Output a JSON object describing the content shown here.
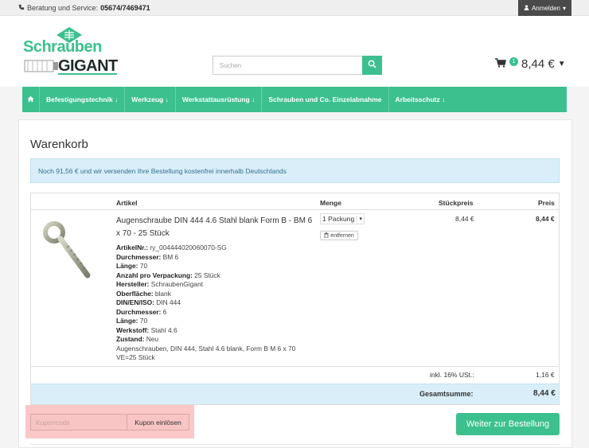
{
  "topbar": {
    "service_label": "Beratung und Service:",
    "service_phone": "05674/7469471",
    "login_label": "Anmelden"
  },
  "header": {
    "logo_top": "Schrauben",
    "logo_bottom": "GIGANT",
    "search_placeholder": "Suchen",
    "cart_count": "1",
    "cart_total": "8,44 €"
  },
  "nav": {
    "items": [
      {
        "label": "Befestigungstechnik",
        "arrow": "🡓"
      },
      {
        "label": "Werkzeug",
        "arrow": "🡓"
      },
      {
        "label": "Werkstattausrüstung",
        "arrow": "🡓"
      },
      {
        "label": "Schrauben und Co. Einzelabnahme",
        "arrow": ""
      },
      {
        "label": "Arbeitsschutz",
        "arrow": "🡓"
      }
    ]
  },
  "cart": {
    "title": "Warenkorb",
    "notice": "Noch 91,56 € und wir versenden Ihre Bestellung kostenfrei innerhalb Deutschlands",
    "headers": {
      "article": "Artikel",
      "qty": "Menge",
      "unit_price": "Stückpreis",
      "price": "Preis"
    },
    "item": {
      "name": "Augenschraube DIN 444 4.6 Stahl blank Form B - BM 6 x 70 - 25 Stück",
      "attributes": [
        {
          "k": "ArtikelNr.:",
          "v": "ry_004444020060070-SG"
        },
        {
          "k": "Durchmesser:",
          "v": "BM 6"
        },
        {
          "k": "Länge:",
          "v": "70"
        },
        {
          "k": "Anzahl pro Verpackung:",
          "v": "25 Stück"
        },
        {
          "k": "Hersteller:",
          "v": "SchraubenGigant"
        },
        {
          "k": "Oberfläche:",
          "v": "blank"
        },
        {
          "k": "DIN/EN/ISO:",
          "v": "DIN 444"
        },
        {
          "k": "Durchmesser:",
          "v": "6"
        },
        {
          "k": "Länge:",
          "v": "70"
        },
        {
          "k": "Werkstoff:",
          "v": "Stahl 4.6"
        },
        {
          "k": "Zustand:",
          "v": "Neu"
        }
      ],
      "description": "Augenschrauben, DIN 444, Stahl 4.6 blank, Form B M 6 x 70 VE=25 Stück",
      "qty": "1 Packung",
      "remove_label": "entfernen",
      "unit_price": "8,44 €",
      "price": "8,44 €"
    },
    "tax_label": "inkl. 16% USt.:",
    "tax_value": "1,16 €",
    "total_label": "Gesamtsumme:",
    "total_value": "8,44 €",
    "coupon_placeholder": "Kuponcode",
    "coupon_button": "Kupon einlösen",
    "checkout_button": "Weiter zur Bestellung"
  },
  "colors": {
    "brand": "#3cc08e",
    "info_bg": "#d9eef9",
    "highlight": "#fbc7c7"
  }
}
